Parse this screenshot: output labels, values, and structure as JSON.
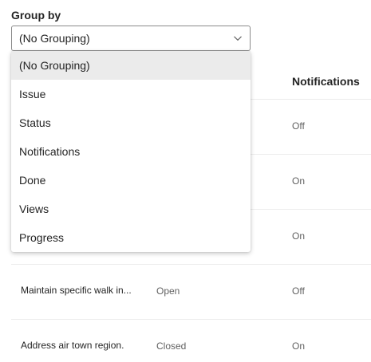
{
  "group_by": {
    "label": "Group by",
    "selected": "(No Grouping)",
    "options": [
      "(No Grouping)",
      "Issue",
      "Status",
      "Notifications",
      "Done",
      "Views",
      "Progress"
    ]
  },
  "table": {
    "headers": {
      "notifications": "Notifications"
    },
    "rows": [
      {
        "issue": "",
        "status": "",
        "notifications": "Off"
      },
      {
        "issue": "",
        "status": "",
        "notifications": "On"
      },
      {
        "issue": "",
        "status": "",
        "notifications": "On"
      },
      {
        "issue": "Maintain specific walk in...",
        "status": "Open",
        "notifications": "Off"
      },
      {
        "issue": "Address air town region.",
        "status": "Closed",
        "notifications": "On"
      }
    ]
  },
  "colors": {
    "selected_option_bg": "#ebebeb",
    "border": "#8a8a8a"
  },
  "icons": {
    "dropdown_chevron": "chevron-down-icon"
  }
}
